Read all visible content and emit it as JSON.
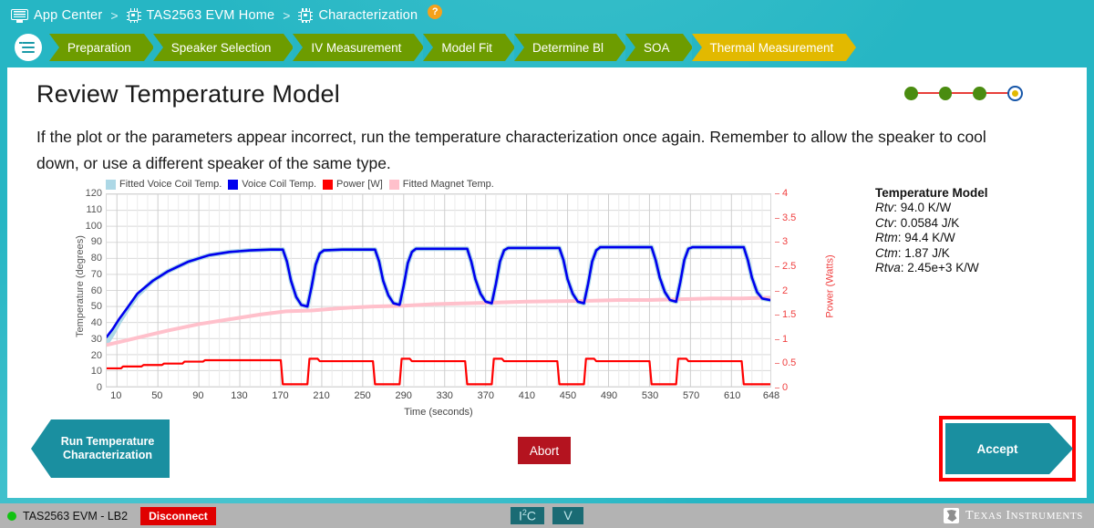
{
  "breadcrumb": {
    "items": [
      {
        "label": "App Center",
        "icon": "appcenter-icon"
      },
      {
        "label": "TAS2563 EVM Home",
        "icon": "chip-icon"
      },
      {
        "label": "Characterization",
        "icon": "chip-icon"
      }
    ],
    "separator": ">",
    "help_label": "?"
  },
  "stepbar": {
    "menu_icon": "hamburger-menu-icon",
    "steps": [
      {
        "label": "Preparation",
        "current": false
      },
      {
        "label": "Speaker Selection",
        "current": false
      },
      {
        "label": "IV Measurement",
        "current": false
      },
      {
        "label": "Model Fit",
        "current": false
      },
      {
        "label": "Determine Bl",
        "current": false
      },
      {
        "label": "SOA",
        "current": false
      },
      {
        "label": "Thermal Measurement",
        "current": true
      }
    ]
  },
  "page": {
    "title": "Review Temperature Model",
    "intro": "If the plot or the parameters appear incorrect, run the temperature characterization once again. Remember to allow the speaker to cool down, or use a different speaker of the same type."
  },
  "progress_dots": [
    {
      "state": "complete"
    },
    {
      "state": "complete"
    },
    {
      "state": "complete"
    },
    {
      "state": "active"
    }
  ],
  "model": {
    "heading": "Temperature Model",
    "rows": [
      {
        "name": "Rtv",
        "value": ": 94.0 K/W"
      },
      {
        "name": "Ctv",
        "value": ": 0.0584 J/K"
      },
      {
        "name": "Rtm",
        "value": ": 94.4 K/W"
      },
      {
        "name": "Ctm",
        "value": ": 1.87 J/K"
      },
      {
        "name": "Rtva",
        "value": ": 2.45e+3 K/W"
      }
    ]
  },
  "buttons": {
    "run": "Run Temperature Characterization",
    "abort": "Abort",
    "accept": "Accept"
  },
  "statusbar": {
    "device": "TAS2563 EVM - LB2",
    "disconnect": "Disconnect",
    "badge_i2c_main": "I",
    "badge_i2c_sup": "2",
    "badge_i2c_tail": "C",
    "badge_v": "V",
    "brand_first": "T",
    "brand_first_rest": "EXAS",
    "brand_second": "I",
    "brand_second_rest": "NSTRUMENTS"
  },
  "chart_data": {
    "type": "line",
    "title": "",
    "xlabel": "Time (seconds)",
    "ylabel": "Temperature (degrees)",
    "y2label": "Power (Watts)",
    "xlim": [
      0,
      648
    ],
    "ylim": [
      0,
      120
    ],
    "y2lim": [
      0,
      4
    ],
    "grid": true,
    "legend_position": "top-left",
    "xticks": [
      10,
      50,
      90,
      130,
      170,
      210,
      250,
      290,
      330,
      370,
      410,
      450,
      490,
      530,
      570,
      610,
      648
    ],
    "yticks": [
      0,
      10,
      20,
      30,
      40,
      50,
      60,
      70,
      80,
      90,
      100,
      110,
      120
    ],
    "y2ticks": [
      0,
      0.5,
      1,
      1.5,
      2,
      2.5,
      3,
      3.5,
      4
    ],
    "colors": {
      "fitted_voice_coil": "#add8e6",
      "voice_coil": "#0000ee",
      "power": "#ff0000",
      "fitted_magnet": "#ffc0cb"
    },
    "series": [
      {
        "name": "Fitted Voice Coil Temp.",
        "axis": "left",
        "color": "#add8e6",
        "width": 5,
        "points": [
          [
            0,
            27
          ],
          [
            6,
            33
          ],
          [
            12,
            40
          ],
          [
            20,
            48
          ],
          [
            30,
            57
          ],
          [
            45,
            66
          ],
          [
            60,
            72
          ],
          [
            80,
            78
          ],
          [
            100,
            82
          ],
          [
            120,
            84
          ],
          [
            140,
            85
          ],
          [
            160,
            85.5
          ],
          [
            172,
            85.5
          ],
          [
            176,
            78
          ],
          [
            180,
            66
          ],
          [
            185,
            56
          ],
          [
            190,
            51
          ],
          [
            196,
            50
          ],
          [
            200,
            62
          ],
          [
            204,
            76
          ],
          [
            208,
            83
          ],
          [
            212,
            85
          ],
          [
            230,
            85.5
          ],
          [
            250,
            85.5
          ],
          [
            262,
            85.5
          ],
          [
            266,
            78
          ],
          [
            270,
            66
          ],
          [
            275,
            57
          ],
          [
            280,
            52
          ],
          [
            286,
            51
          ],
          [
            290,
            63
          ],
          [
            294,
            77
          ],
          [
            298,
            84
          ],
          [
            302,
            86
          ],
          [
            320,
            86
          ],
          [
            340,
            86
          ],
          [
            352,
            86
          ],
          [
            356,
            78
          ],
          [
            360,
            67
          ],
          [
            365,
            58
          ],
          [
            370,
            53
          ],
          [
            376,
            52
          ],
          [
            380,
            64
          ],
          [
            384,
            78
          ],
          [
            388,
            85
          ],
          [
            392,
            86.5
          ],
          [
            410,
            86.5
          ],
          [
            430,
            86.5
          ],
          [
            442,
            86.5
          ],
          [
            446,
            79
          ],
          [
            450,
            67
          ],
          [
            455,
            58
          ],
          [
            460,
            53
          ],
          [
            466,
            52
          ],
          [
            470,
            64
          ],
          [
            474,
            78
          ],
          [
            478,
            85
          ],
          [
            482,
            87
          ],
          [
            500,
            87
          ],
          [
            520,
            87
          ],
          [
            532,
            87
          ],
          [
            536,
            79
          ],
          [
            540,
            68
          ],
          [
            545,
            59
          ],
          [
            550,
            54
          ],
          [
            556,
            53
          ],
          [
            560,
            65
          ],
          [
            564,
            79
          ],
          [
            568,
            86
          ],
          [
            572,
            87
          ],
          [
            590,
            87
          ],
          [
            610,
            87
          ],
          [
            622,
            87
          ],
          [
            626,
            79
          ],
          [
            630,
            68
          ],
          [
            635,
            59
          ],
          [
            640,
            55
          ],
          [
            648,
            54
          ]
        ]
      },
      {
        "name": "Voice Coil Temp.",
        "axis": "left",
        "color": "#0000ee",
        "width": 2.6,
        "points": [
          [
            0,
            31
          ],
          [
            6,
            36
          ],
          [
            12,
            42
          ],
          [
            20,
            49
          ],
          [
            30,
            58
          ],
          [
            45,
            66
          ],
          [
            60,
            72
          ],
          [
            80,
            78
          ],
          [
            100,
            82
          ],
          [
            120,
            84
          ],
          [
            140,
            85
          ],
          [
            160,
            85.5
          ],
          [
            172,
            85.5
          ],
          [
            176,
            78
          ],
          [
            180,
            66
          ],
          [
            185,
            56
          ],
          [
            190,
            51
          ],
          [
            196,
            50
          ],
          [
            200,
            62
          ],
          [
            204,
            76
          ],
          [
            208,
            83
          ],
          [
            212,
            85
          ],
          [
            230,
            85.5
          ],
          [
            250,
            85.5
          ],
          [
            262,
            85.5
          ],
          [
            266,
            78
          ],
          [
            270,
            66
          ],
          [
            275,
            57
          ],
          [
            280,
            52
          ],
          [
            286,
            51
          ],
          [
            290,
            63
          ],
          [
            294,
            77
          ],
          [
            298,
            84
          ],
          [
            302,
            86
          ],
          [
            320,
            86
          ],
          [
            340,
            86
          ],
          [
            352,
            86
          ],
          [
            356,
            78
          ],
          [
            360,
            67
          ],
          [
            365,
            58
          ],
          [
            370,
            53
          ],
          [
            376,
            52
          ],
          [
            380,
            64
          ],
          [
            384,
            78
          ],
          [
            388,
            85
          ],
          [
            392,
            86.5
          ],
          [
            410,
            86.5
          ],
          [
            430,
            86.5
          ],
          [
            442,
            86.5
          ],
          [
            446,
            79
          ],
          [
            450,
            67
          ],
          [
            455,
            58
          ],
          [
            460,
            53
          ],
          [
            466,
            52
          ],
          [
            470,
            64
          ],
          [
            474,
            78
          ],
          [
            478,
            85
          ],
          [
            482,
            87
          ],
          [
            500,
            87
          ],
          [
            520,
            87
          ],
          [
            532,
            87
          ],
          [
            536,
            79
          ],
          [
            540,
            68
          ],
          [
            545,
            59
          ],
          [
            550,
            54
          ],
          [
            556,
            53
          ],
          [
            560,
            65
          ],
          [
            564,
            79
          ],
          [
            568,
            86
          ],
          [
            572,
            87
          ],
          [
            590,
            87
          ],
          [
            610,
            87
          ],
          [
            622,
            87
          ],
          [
            626,
            79
          ],
          [
            630,
            68
          ],
          [
            635,
            59
          ],
          [
            640,
            55
          ],
          [
            648,
            54
          ]
        ]
      },
      {
        "name": "Fitted Magnet Temp.",
        "axis": "left",
        "color": "#ffc0cb",
        "width": 4,
        "points": [
          [
            0,
            26
          ],
          [
            20,
            29
          ],
          [
            40,
            32
          ],
          [
            60,
            35
          ],
          [
            90,
            39
          ],
          [
            120,
            42
          ],
          [
            150,
            45
          ],
          [
            175,
            47
          ],
          [
            200,
            47.5
          ],
          [
            230,
            49
          ],
          [
            260,
            50
          ],
          [
            290,
            50.5
          ],
          [
            320,
            51.5
          ],
          [
            350,
            52
          ],
          [
            380,
            52.5
          ],
          [
            410,
            53
          ],
          [
            440,
            53.3
          ],
          [
            470,
            53.5
          ],
          [
            500,
            54
          ],
          [
            530,
            54
          ],
          [
            560,
            54.5
          ],
          [
            590,
            55
          ],
          [
            620,
            55
          ],
          [
            648,
            55.5
          ]
        ]
      },
      {
        "name": "Power [W]",
        "axis": "right",
        "color": "#ff0000",
        "width": 2.2,
        "points": [
          [
            0,
            0.38
          ],
          [
            14,
            0.38
          ],
          [
            16,
            0.42
          ],
          [
            34,
            0.42
          ],
          [
            36,
            0.45
          ],
          [
            54,
            0.45
          ],
          [
            56,
            0.48
          ],
          [
            74,
            0.48
          ],
          [
            76,
            0.52
          ],
          [
            94,
            0.52
          ],
          [
            96,
            0.55
          ],
          [
            170,
            0.55
          ],
          [
            172,
            0.05
          ],
          [
            196,
            0.05
          ],
          [
            198,
            0.58
          ],
          [
            206,
            0.58
          ],
          [
            208,
            0.53
          ],
          [
            260,
            0.53
          ],
          [
            262,
            0.05
          ],
          [
            286,
            0.05
          ],
          [
            288,
            0.58
          ],
          [
            296,
            0.58
          ],
          [
            298,
            0.53
          ],
          [
            350,
            0.53
          ],
          [
            352,
            0.05
          ],
          [
            376,
            0.05
          ],
          [
            378,
            0.58
          ],
          [
            386,
            0.58
          ],
          [
            388,
            0.53
          ],
          [
            440,
            0.53
          ],
          [
            442,
            0.05
          ],
          [
            466,
            0.05
          ],
          [
            468,
            0.58
          ],
          [
            476,
            0.58
          ],
          [
            478,
            0.53
          ],
          [
            530,
            0.53
          ],
          [
            532,
            0.05
          ],
          [
            556,
            0.05
          ],
          [
            558,
            0.58
          ],
          [
            566,
            0.58
          ],
          [
            568,
            0.53
          ],
          [
            620,
            0.53
          ],
          [
            622,
            0.05
          ],
          [
            646,
            0.05
          ],
          [
            648,
            0.05
          ]
        ]
      }
    ]
  }
}
